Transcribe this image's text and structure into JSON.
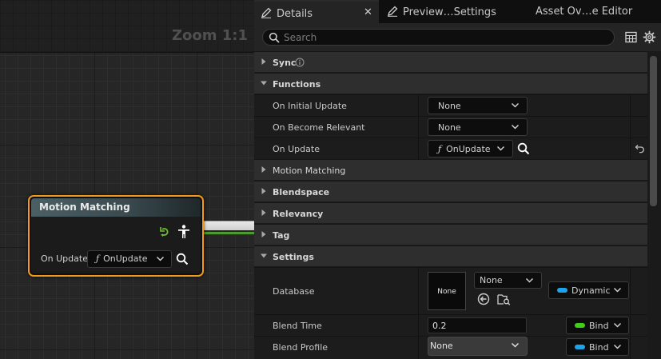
{
  "graph": {
    "zoom_label": "Zoom 1:1",
    "node": {
      "title": "Motion Matching",
      "pin_label": "On Update",
      "function_glyph": "ƒ",
      "function_value": "OnUpdate",
      "header_color": "#4a6065",
      "selection_color": "#f29a1b"
    }
  },
  "tabs": [
    {
      "label": "Details",
      "icon": "pencil-icon",
      "active": true,
      "closable": true
    },
    {
      "label": "Preview…Settings",
      "icon": "pencil-icon",
      "active": false
    },
    {
      "label": "Asset Ov…e Editor",
      "active": false
    }
  ],
  "search": {
    "placeholder": "Search",
    "value": ""
  },
  "toolbar_icons": [
    "table-icon",
    "gear-icon"
  ],
  "details": {
    "sync": {
      "label": "Sync",
      "expanded": false
    },
    "functions": {
      "label": "Functions",
      "expanded": true,
      "rows": [
        {
          "name": "On Initial Update",
          "value": "None"
        },
        {
          "name": "On Become Relevant",
          "value": "None"
        },
        {
          "name": "On Update",
          "glyph": "ƒ",
          "value": "OnUpdate"
        }
      ]
    },
    "collapsed_categories": [
      "Motion Matching",
      "Blendspace",
      "Relevancy",
      "Tag"
    ],
    "settings": {
      "label": "Settings",
      "expanded": true,
      "database": {
        "name": "Database",
        "thumbnail_text": "None",
        "asset_value": "None",
        "bind_value": "Dynamic",
        "bind_color": "#1fa3e8"
      },
      "blend_time": {
        "name": "Blend Time",
        "value": "0.2",
        "bind_value": "Bind",
        "bind_color": "#3fcf19"
      },
      "blend_profile": {
        "name": "Blend Profile",
        "value": "None",
        "bind_value": "Bind",
        "bind_color": "#1fa3e8"
      }
    }
  }
}
